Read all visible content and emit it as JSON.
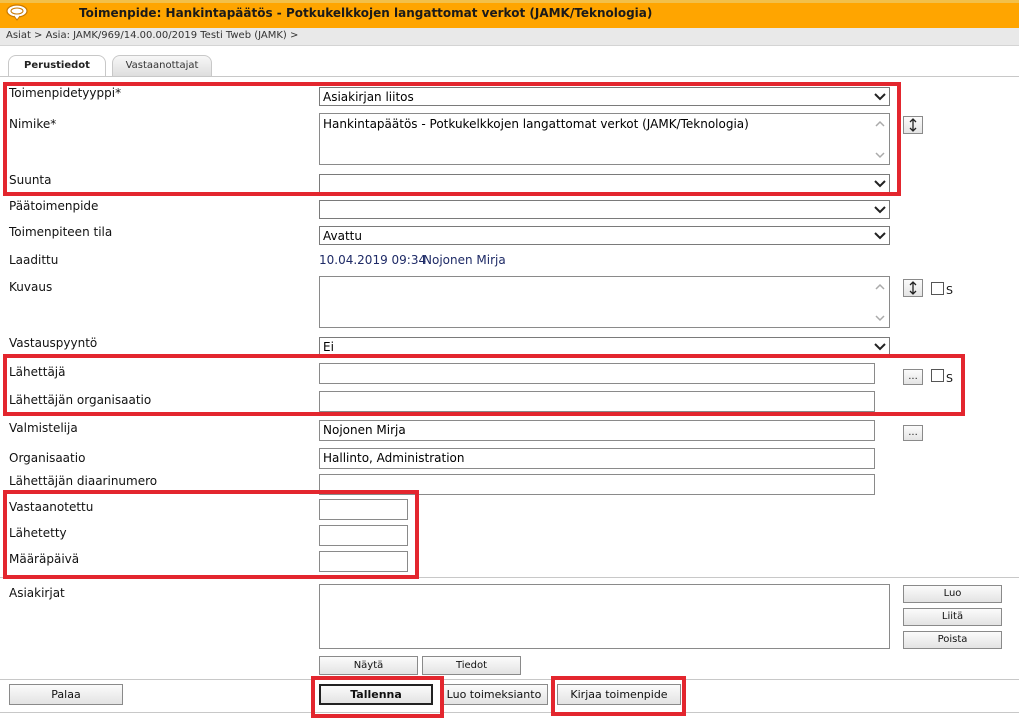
{
  "window": {
    "title": "Toimenpide: Hankintapäätös - Potkukelkkojen langattomat verkot (JAMK/Teknologia)",
    "breadcrumb": "Asiat > Asia: JAMK/969/14.00.00/2019 Testi Tweb (JAMK) >"
  },
  "tabs": [
    {
      "label": "Perustiedot",
      "active": true
    },
    {
      "label": "Vastaanottajat",
      "active": false
    }
  ],
  "fields": {
    "toimenpidetyyppi": {
      "label": "Toimenpidetyyppi*",
      "value": "Asiakirjan liitos"
    },
    "nimike": {
      "label": "Nimike*",
      "value": "Hankintapäätös - Potkukelkkojen langattomat verkot (JAMK/Teknologia)"
    },
    "suunta": {
      "label": "Suunta",
      "value": ""
    },
    "paatoimenpide": {
      "label": "Päätoimenpide",
      "value": ""
    },
    "tila": {
      "label": "Toimenpiteen tila",
      "value": "Avattu"
    },
    "laadittu": {
      "label": "Laadittu",
      "date": "10.04.2019 09:34",
      "author": "Nojonen Mirja"
    },
    "kuvaus": {
      "label": "Kuvaus",
      "value": "",
      "s_label": "S"
    },
    "vastauspyynto": {
      "label": "Vastauspyyntö",
      "value": "Ei"
    },
    "lahettaja": {
      "label": "Lähettäjä",
      "value": "",
      "browse": "...",
      "s_label": "S"
    },
    "lahettajan_org": {
      "label": "Lähettäjän organisaatio",
      "value": ""
    },
    "valmistelija": {
      "label": "Valmistelija",
      "value": "Nojonen Mirja",
      "browse": "..."
    },
    "organisaatio": {
      "label": "Organisaatio",
      "value": "Hallinto, Administration"
    },
    "diaarinumero": {
      "label": "Lähettäjän diaarinumero",
      "value": ""
    },
    "vastaanotettu": {
      "label": "Vastaanotettu",
      "value": ""
    },
    "lahetetty": {
      "label": "Lähetetty",
      "value": ""
    },
    "maarapaiva": {
      "label": "Määräpäivä",
      "value": ""
    },
    "asiakirjat": {
      "label": "Asiakirjat"
    }
  },
  "documents_buttons": {
    "luo": "Luo",
    "liita": "Liitä",
    "poista": "Poista",
    "nayta": "Näytä",
    "tiedot": "Tiedot"
  },
  "footer": {
    "palaa": "Palaa",
    "tallenna": "Tallenna",
    "luo_toimeksianto": "Luo toimeksianto",
    "kirjaa_toimenpide": "Kirjaa toimenpide"
  },
  "colors": {
    "titlebar": "#ffa500",
    "highlight": "#e3262e",
    "link": "#1e2a66"
  }
}
